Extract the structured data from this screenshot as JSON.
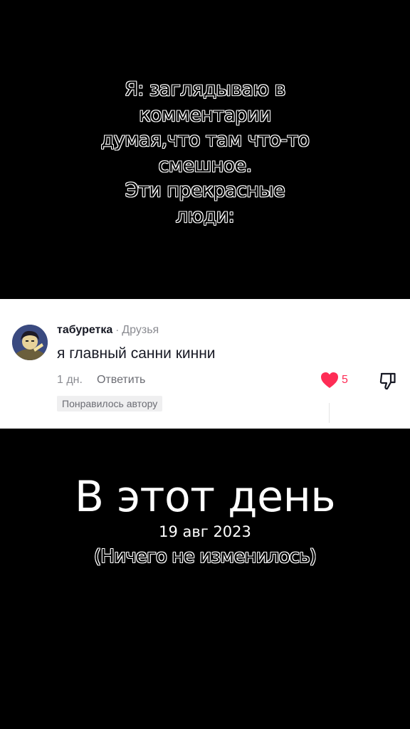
{
  "caption": {
    "lines": [
      "Я: заглядываю в",
      "комментарии",
      "думая,что там что-то",
      "смешное.",
      "Эти прекрасные",
      "люди:"
    ]
  },
  "comment": {
    "username": "табуретка",
    "separator": "·",
    "relation": "Друзья",
    "text": "я главный санни кинни",
    "time": "1 дн.",
    "reply_label": "Ответить",
    "liked_by_author": "Понравилось автору",
    "like_count": "5",
    "icons": {
      "avatar": "avatar",
      "like": "heart-icon",
      "dislike": "thumbs-down-icon"
    },
    "colors": {
      "like": "#fe2c55",
      "muted": "#8a8b91"
    }
  },
  "overlay": {
    "title": "В этот день",
    "date": "19 авг 2023",
    "note": "(Ничего не изменилось)"
  }
}
